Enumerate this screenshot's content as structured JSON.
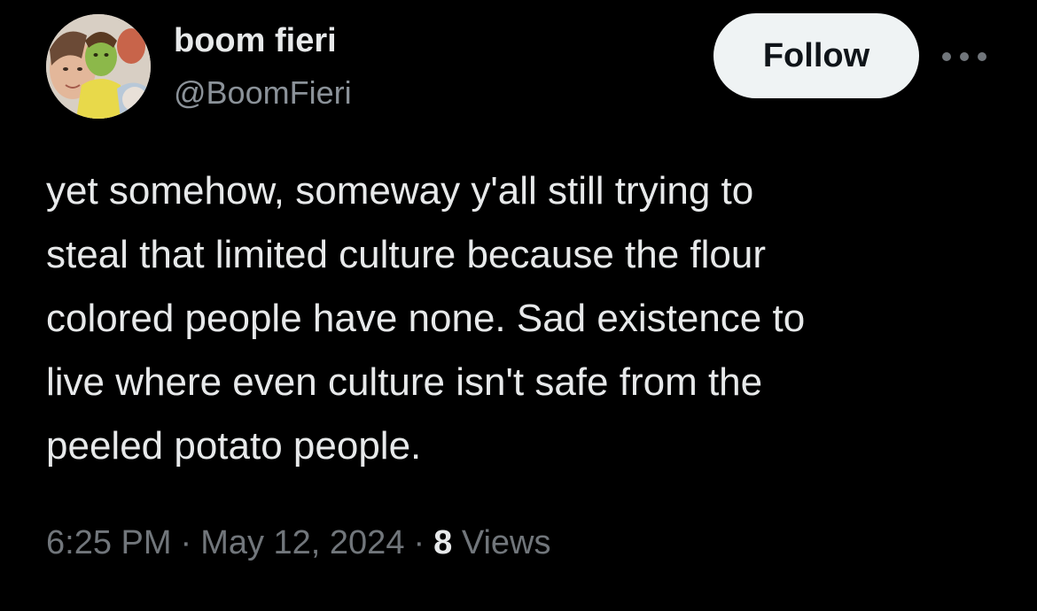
{
  "author": {
    "display_name": "boom fieri",
    "handle": "@BoomFieri",
    "avatar": "avatar-image"
  },
  "actions": {
    "follow_label": "Follow",
    "more_icon": "more-horizontal-icon"
  },
  "tweet": {
    "text": "yet somehow, someway y'all still trying to\nsteal that limited culture because the flour\ncolored people have none. Sad existence to\nlive where even culture isn't safe from the\npeeled potato people."
  },
  "meta": {
    "time": "6:25 PM",
    "separator": "·",
    "date": "May 12, 2024",
    "views_count": "8",
    "views_label": "Views"
  },
  "colors": {
    "background": "#000000",
    "primary_text": "#e7e9ea",
    "secondary_text": "#71767b",
    "follow_bg": "#eff3f4",
    "follow_text": "#0f1419"
  }
}
